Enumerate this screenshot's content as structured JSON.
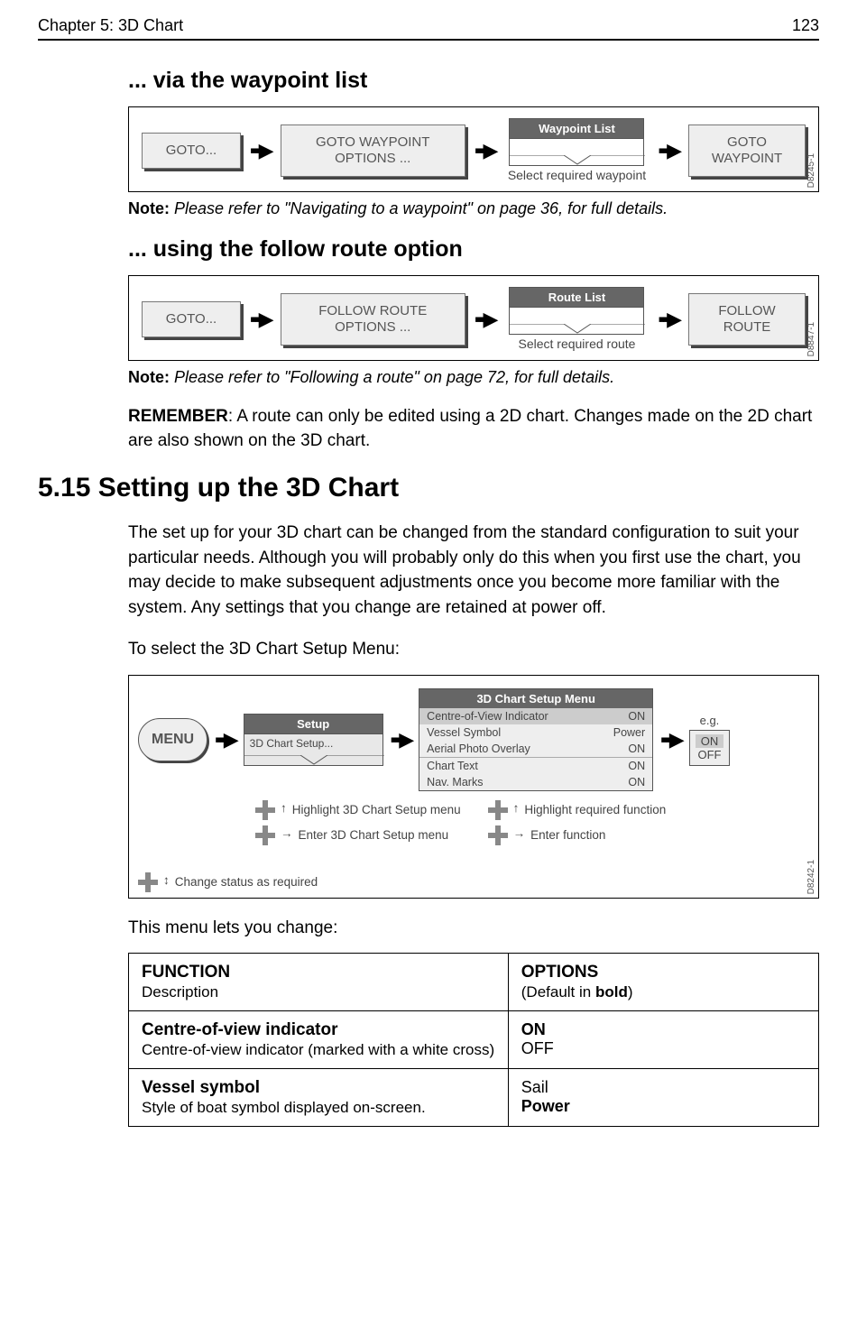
{
  "header": {
    "chapter": "Chapter 5: 3D Chart",
    "page": "123"
  },
  "sub1": {
    "title": "... via the waypoint list",
    "flow": {
      "k1": "GOTO...",
      "k2": "GOTO WAYPOINT OPTIONS ...",
      "list_title": "Waypoint List",
      "caption": "Select required waypoint",
      "k3": "GOTO WAYPOINT",
      "figid": "D8245-1"
    },
    "note_label": "Note:",
    "note_text": "Please refer to \"Navigating to a waypoint\" on page 36, for full details."
  },
  "sub2": {
    "title": "... using the follow route option",
    "flow": {
      "k1": "GOTO...",
      "k2": "FOLLOW ROUTE OPTIONS ...",
      "list_title": "Route List",
      "caption": "Select required route",
      "k3": "FOLLOW ROUTE",
      "figid": "D8847-1"
    },
    "note_label": "Note:",
    "note_text": "Please refer to \"Following a route\" on page 72, for full details.",
    "remember_label": "REMEMBER",
    "remember_text": ": A route can only be edited using a 2D chart. Changes made on the 2D chart are also shown on the 3D chart."
  },
  "section": {
    "title": "5.15 Setting up the 3D Chart",
    "para1": "The set up for your 3D chart can be changed from the standard configuration to suit your particular needs. Although you will probably only do this when you first use the chart, you may decide to make subsequent adjustments once you become more familiar with the system. Any settings that you change are retained at power off.",
    "para2": "To select the 3D Chart Setup Menu:"
  },
  "menuflow": {
    "menu_btn": "MENU",
    "setup_tab": "Setup",
    "setup_item": "3D Chart Setup...",
    "card_title": "3D Chart Setup Menu",
    "rows": [
      {
        "name": "Centre-of-View Indicator",
        "val": "ON",
        "sel": true
      },
      {
        "name": "Vessel Symbol",
        "val": "Power",
        "sel": false
      },
      {
        "name": "Aerial Photo Overlay",
        "val": "ON",
        "sel": false
      }
    ],
    "rows2": [
      {
        "name": "Chart Text",
        "val": "ON"
      },
      {
        "name": "Nav. Marks",
        "val": "ON"
      }
    ],
    "eg_label": "e.g.",
    "eg_opts": [
      "ON",
      "OFF"
    ],
    "hints": {
      "h1": "Highlight 3D Chart Setup menu",
      "h2": "Enter 3D Chart Setup menu",
      "h3": "Highlight required function",
      "h4": "Enter function",
      "h5": "Change status as required"
    },
    "figid": "D8242-1"
  },
  "para3": "This menu lets you change:",
  "table": {
    "hdr_fn": "FUNCTION",
    "hdr_fn_sub": "Description",
    "hdr_opt": "OPTIONS",
    "hdr_opt_sub": "(Default in ",
    "hdr_opt_sub_bold": "bold",
    "hdr_opt_sub_end": ")",
    "r1_fn": "Centre-of-view indicator",
    "r1_desc": "Centre-of-view indicator (marked with a white cross)",
    "r1_opts": [
      "ON",
      "OFF"
    ],
    "r1_default_idx": 0,
    "r2_fn": "Vessel symbol",
    "r2_desc": "Style of boat symbol displayed on-screen.",
    "r2_opts": [
      "Sail",
      "Power"
    ],
    "r2_default_idx": 1
  }
}
